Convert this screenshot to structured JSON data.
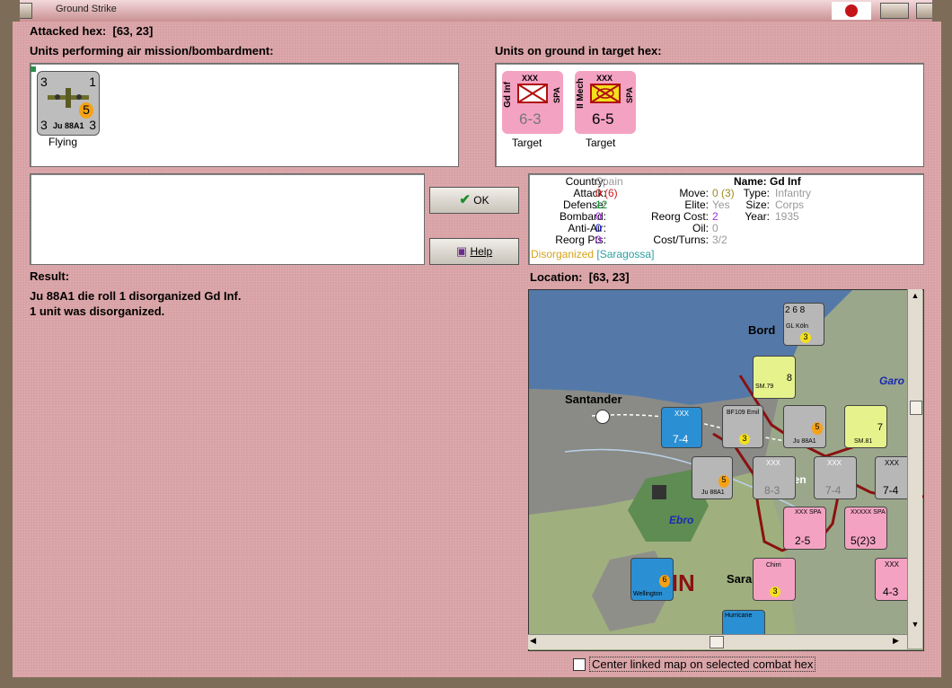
{
  "window": {
    "title": "Ground Strike"
  },
  "attacked_hex": {
    "label": "Attacked hex:",
    "value": "[63, 23]"
  },
  "air_units": {
    "heading": "Units performing air mission/bombardment:",
    "items": [
      {
        "name": "Ju 88A1",
        "left": "3",
        "right": "1",
        "strength": "5",
        "bottom_left": "3",
        "bottom_right": "3",
        "status": "Flying"
      }
    ]
  },
  "ground_units": {
    "heading": "Units on ground in target hex:",
    "items": [
      {
        "side": "Gd Inf",
        "size": "XXX",
        "nation": "SPA",
        "value": "6-3",
        "status": "Target"
      },
      {
        "side": "II Mech",
        "size": "XXX",
        "nation": "SPA",
        "value": "6-5",
        "status": "Target"
      }
    ]
  },
  "buttons": {
    "ok": "OK",
    "help": "Help"
  },
  "details": {
    "country_label": "Country:",
    "country": "Spain",
    "attack_label": "Attack:",
    "attack": "0 (6)",
    "defense_label": "Defense:",
    "defense": "12",
    "bombard_label": "Bombard:",
    "bombard": "0",
    "antiair_label": "Anti-Air:",
    "antiair": "0",
    "reorg_pts_label": "Reorg Pts:",
    "reorg_pts": "0",
    "name_label": "Name:",
    "name": "Gd Inf",
    "move_label": "Move:",
    "move": "0 (3)",
    "elite_label": "Elite:",
    "elite": "Yes",
    "reorg_cost_label": "Reorg Cost:",
    "reorg_cost": "2",
    "oil_label": "Oil:",
    "oil": "0",
    "cost_turns_label": "Cost/Turns:",
    "cost_turns": "3/2",
    "type_label": "Type:",
    "type": "Infantry",
    "size_label": "Size:",
    "size": "Corps",
    "year_label": "Year:",
    "year": "1935",
    "status": "Disorganized",
    "location_tag": "[Saragossa]"
  },
  "result": {
    "heading": "Result:",
    "line1": "Ju 88A1 die roll 1 disorganized Gd Inf.",
    "line2": "1 unit was disorganized."
  },
  "location": {
    "label": "Location:",
    "value": "[63, 23]"
  },
  "map": {
    "labels": {
      "santander": "Santander",
      "bord": "Bord",
      "ebro": "Ebro",
      "garo": "Garo",
      "spain": "AIN",
      "sara": "Sara",
      "tre": "ren"
    },
    "counters": [
      {
        "t": "5",
        "b": "2 6 8",
        "n": "GL Köln",
        "s": "3"
      },
      {
        "t": "2",
        "n": "SM.79",
        "s": "8"
      },
      {
        "t": "3",
        "n": "XXX",
        "s": "7-4"
      },
      {
        "t": "6",
        "n": "BF109 Emil",
        "s": "3"
      },
      {
        "t": "2",
        "n": "Ju 88A1",
        "s": "5"
      },
      {
        "t": "2",
        "n": "SM.81",
        "s": "7"
      },
      {
        "t": "3",
        "n": "Ju 88A1",
        "s": "5"
      },
      {
        "t": "2",
        "n": "XXX",
        "s": "8-3"
      },
      {
        "t": "2",
        "n": "XXX",
        "s": "7-4"
      },
      {
        "t": "2",
        "n": "XXX",
        "s": "7-4"
      },
      {
        "t": "2",
        "n": "XXX SPA",
        "s": "2-5"
      },
      {
        "t": "2",
        "n": "XXXXX SPA",
        "s": "5(2)3"
      },
      {
        "t": "3",
        "n": "Chirri",
        "s": "3"
      },
      {
        "t": "2",
        "n": "Wellington",
        "s": "6"
      },
      {
        "t": "",
        "n": "XXX",
        "s": "4-3"
      },
      {
        "t": "4",
        "n": "Hurricane",
        "s": ""
      }
    ]
  },
  "center_option": {
    "label": "Center linked map on selected combat hex"
  },
  "colors": {
    "background": "#d8a1a4",
    "counter_pink": "#f4a2c2",
    "counter_gray": "#b7b7b7",
    "counter_blue": "#2b8fd3",
    "counter_yellow": "#e6f28c"
  }
}
